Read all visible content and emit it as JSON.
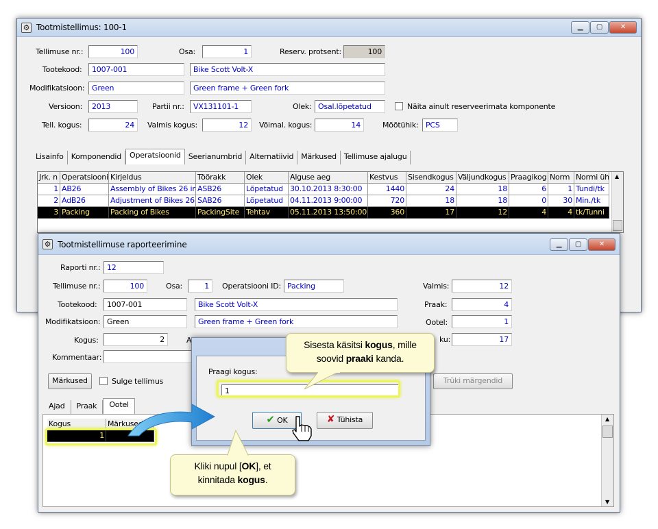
{
  "main_window": {
    "title": "Tootmistellimus: 100-1",
    "labels": {
      "order_nr": "Tellimuse nr.:",
      "part": "Osa:",
      "reserve_pct": "Reserv. protsent:",
      "product_code": "Tootekood:",
      "modification": "Modifikatsioon:",
      "version": "Versioon:",
      "batch_nr": "Partii nr.:",
      "status": "Olek:",
      "show_unreserved": "Näita ainult reserveerimata komponente",
      "ordered_qty": "Tell. kogus:",
      "done_qty": "Valmis kogus:",
      "possible_qty": "Võimal. kogus:",
      "unit": "Mõõtühik:"
    },
    "values": {
      "order_nr": "100",
      "part": "1",
      "reserve_pct": "100",
      "product_code": "1007-001",
      "product_name": "Bike Scott Volt-X",
      "modification": "Green",
      "modification_desc": "Green frame + Green fork",
      "version": "2013",
      "batch_nr": "VX131101-1",
      "status": "Osal.lõpetatud",
      "ordered_qty": "24",
      "done_qty": "12",
      "possible_qty": "14",
      "unit": "PCS"
    },
    "tabs": [
      "Lisainfo",
      "Komponendid",
      "Operatsioonid",
      "Seerianumbrid",
      "Alternatiivid",
      "Märkused",
      "Tellimuse ajalugu"
    ],
    "active_tab": "Operatsioonid",
    "ops_table": {
      "columns": [
        "Jrk. n",
        "Operatsiooni",
        "Kirjeldus",
        "Töörakk",
        "Olek",
        "Alguse aeg",
        "Kestvus",
        "Sisendkogus",
        "Väljundkogus",
        "Praagikog",
        "Norm",
        "Normi üh"
      ],
      "rows": [
        [
          "1",
          "AB26",
          "Assembly of Bikes 26 in",
          "ASB26",
          "Lõpetatud",
          "30.10.2013 8:30:00",
          "1440",
          "24",
          "18",
          "6",
          "1",
          "Tundi/tk"
        ],
        [
          "2",
          "AdB26",
          "Adjustment of Bikes 26",
          "SAB26",
          "Lõpetatud",
          "04.11.2013 9:00:00",
          "720",
          "18",
          "18",
          "0",
          "30",
          "Min./tk"
        ],
        [
          "3",
          "Packing",
          "Packing of Bikes",
          "PackingSite",
          "Tehtav",
          "05.11.2013 13:50:00",
          "360",
          "17",
          "12",
          "4",
          "4",
          "tk/Tunni"
        ]
      ]
    }
  },
  "report_window": {
    "title": "Tootmistellimuse raporteerimine",
    "labels": {
      "report_nr": "Raporti nr.:",
      "order_nr": "Tellimuse nr.:",
      "part": "Osa:",
      "op_id": "Operatsiooni ID:",
      "product_code": "Tootekood:",
      "modification": "Modifikatsioon:",
      "quantity": "Kogus:",
      "comment": "Kommentaar:",
      "done": "Valmis:",
      "scrap": "Praak:",
      "waiting": "Ootel:",
      "fourth_tail": "ku:",
      "a_fragment": "A"
    },
    "values": {
      "report_nr": "12",
      "order_nr": "100",
      "part": "1",
      "op_id": "Packing",
      "product_code": "1007-001",
      "product_name": "Bike Scott Volt-X",
      "modification": "Green",
      "modification_desc": "Green frame + Green fork",
      "quantity": "2",
      "done": "12",
      "scrap": "4",
      "waiting": "1",
      "fourth": "17"
    },
    "notes_button": "Märkused",
    "close_order_label": "Sulge tellimus",
    "print_labels_button": "Trüki märgendid",
    "tabs": [
      "Ajad",
      "Praak",
      "Ootel"
    ],
    "active_tab": "Ootel",
    "waiting_table": {
      "columns": [
        "Kogus",
        "Märkused"
      ],
      "rows": [
        [
          "1",
          ""
        ]
      ]
    }
  },
  "dialog": {
    "label": "Praagi kogus:",
    "value": "1",
    "ok_button": "OK",
    "cancel_button": "Tühista"
  },
  "callouts": {
    "top": {
      "pre": "Sisesta käsitsi ",
      "b1": "kogus",
      "mid": ", mille soovid ",
      "b2": "praaki",
      "post": " kanda."
    },
    "bottom": {
      "pre": "Kliki nupul [",
      "b1": "OK",
      "mid": "], et kinnitada ",
      "b2": "kogus",
      "post": "."
    }
  },
  "colors": {
    "highlight": "#ecf55a",
    "selected_row_bg": "#000000",
    "selected_row_fg": "#ffe66e",
    "value_text": "#0000c8",
    "callout_bg": "#fdfbd6"
  }
}
